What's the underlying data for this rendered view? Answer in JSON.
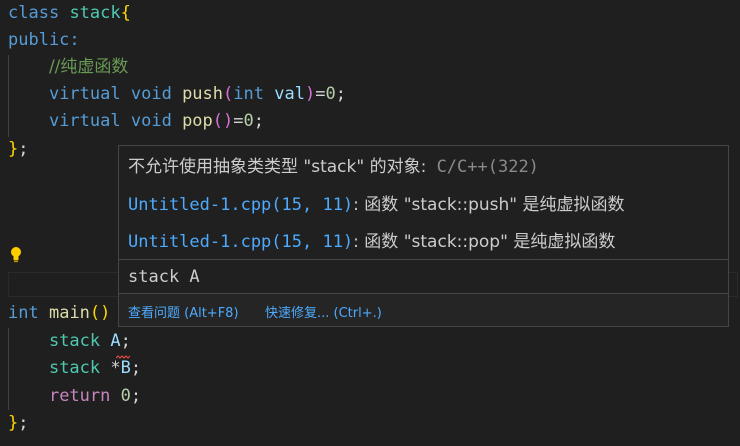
{
  "code": {
    "l1": {
      "kw": "class",
      "name": "stack",
      "brace": "{"
    },
    "l2": {
      "text": "public:"
    },
    "l3": {
      "comment": "//纯虚函数"
    },
    "l4": {
      "kw": "virtual",
      "type": "void",
      "fn": "push",
      "open": "(",
      "ptype": "int",
      "param": "val",
      "close": ")",
      "tail": "=",
      "num": "0",
      "semi": ";"
    },
    "l5": {
      "kw": "virtual",
      "type": "void",
      "fn": "pop",
      "parens": "()",
      "tail": "=",
      "num": "0",
      "semi": ";"
    },
    "l6": {
      "brace": "}",
      "semi": ";"
    },
    "l11": {
      "kw": "int",
      "fn": "main",
      "parens": "()"
    },
    "l12": {
      "type": "stack",
      "var": "A",
      "semi": ";"
    },
    "l13": {
      "type": "stack",
      "star": "*",
      "var": "B",
      "semi": ";"
    },
    "l14": {
      "kw": "return",
      "num": "0",
      "semi": ";"
    },
    "l15": {
      "brace": "}",
      "semi": ";"
    }
  },
  "hover": {
    "title": "不允许使用抽象类类型 \"stack\" 的对象:",
    "code": "C/C++(322)",
    "rows": [
      {
        "link": "Untitled-1.cpp(15, 11)",
        "text": ": 函数 \"stack::push\" 是纯虚拟函数"
      },
      {
        "link": "Untitled-1.cpp(15, 11)",
        "text": ": 函数 \"stack::pop\" 是纯虚拟函数"
      }
    ],
    "type_preview": "stack A",
    "actions": {
      "view_problem": "查看问题 (Alt+F8)",
      "quick_fix": "快速修复... (Ctrl+.)"
    }
  }
}
